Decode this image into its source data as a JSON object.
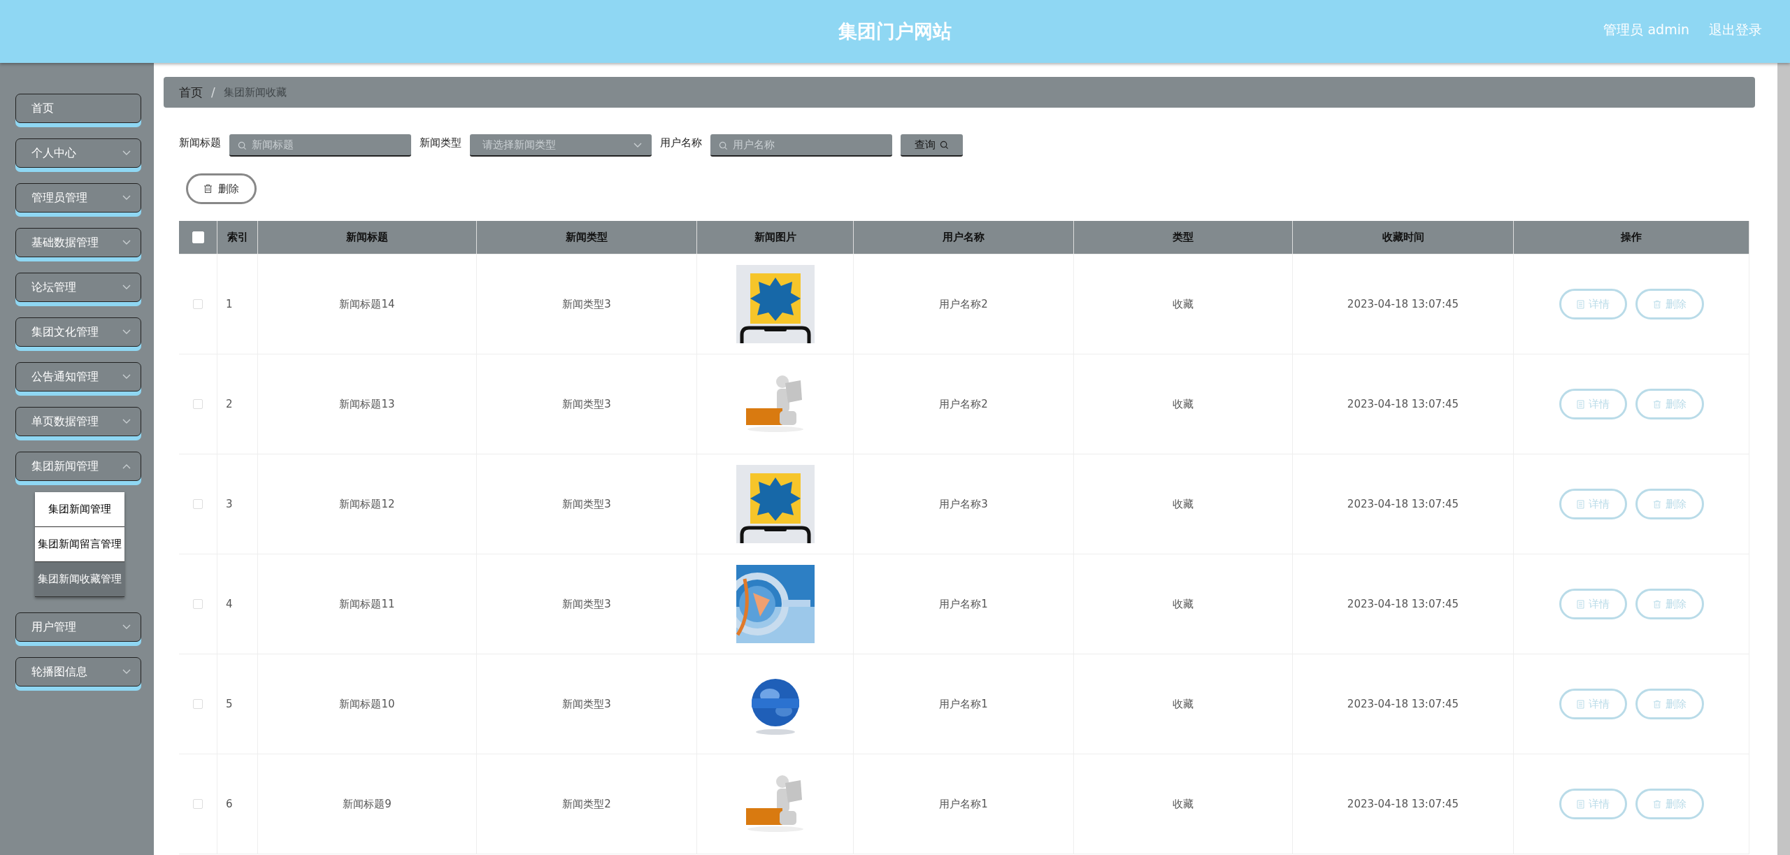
{
  "header": {
    "title": "集团门户网站",
    "user": "管理员 admin",
    "logout": "退出登录"
  },
  "sidebar": {
    "items": [
      {
        "label": "首页",
        "kind": "link"
      },
      {
        "label": "个人中心",
        "kind": "menu",
        "expanded": false
      },
      {
        "label": "管理员管理",
        "kind": "menu",
        "expanded": false
      },
      {
        "label": "基础数据管理",
        "kind": "menu",
        "expanded": false
      },
      {
        "label": "论坛管理",
        "kind": "menu",
        "expanded": false
      },
      {
        "label": "集团文化管理",
        "kind": "menu",
        "expanded": false
      },
      {
        "label": "公告通知管理",
        "kind": "menu",
        "expanded": false
      },
      {
        "label": "单页数据管理",
        "kind": "menu",
        "expanded": false
      },
      {
        "label": "集团新闻管理",
        "kind": "menu",
        "expanded": true,
        "children": [
          {
            "label": "集团新闻管理",
            "selected": false
          },
          {
            "label": "集团新闻留言管理",
            "selected": false
          },
          {
            "label": "集团新闻收藏管理",
            "selected": true
          }
        ]
      },
      {
        "label": "用户管理",
        "kind": "menu",
        "expanded": false
      },
      {
        "label": "轮播图信息",
        "kind": "menu",
        "expanded": false
      }
    ]
  },
  "breadcrumb": {
    "separator": "/",
    "items": [
      "首页",
      "集团新闻收藏"
    ]
  },
  "filters": [
    {
      "label": "新闻标题",
      "kind": "text",
      "placeholder": "新闻标题"
    },
    {
      "label": "新闻类型",
      "kind": "select",
      "placeholder": "请选择新闻类型"
    },
    {
      "label": "用户名称",
      "kind": "text",
      "placeholder": "用户名称"
    }
  ],
  "search_button": "查询",
  "delete_button": "删除",
  "table": {
    "columns": [
      "索引",
      "新闻标题",
      "新闻类型",
      "新闻图片",
      "用户名称",
      "类型",
      "收藏时间",
      "操作"
    ],
    "all_checked": false,
    "rows": [
      {
        "checked": false,
        "index": "1",
        "title": "新闻标题14",
        "news_type": "新闻类型3",
        "image": {
          "kind": "picture"
        },
        "user": "用户名称2",
        "type": "收藏",
        "time": "2023-04-18 13:07:45",
        "actions": [
          "详情",
          "删除"
        ]
      },
      {
        "checked": false,
        "index": "2",
        "title": "新闻标题13",
        "news_type": "新闻类型3",
        "image": {
          "kind": "picture"
        },
        "user": "用户名称2",
        "type": "收藏",
        "time": "2023-04-18 13:07:45",
        "actions": [
          "详情",
          "删除"
        ]
      },
      {
        "checked": false,
        "index": "3",
        "title": "新闻标题12",
        "news_type": "新闻类型3",
        "image": {
          "kind": "picture"
        },
        "user": "用户名称3",
        "type": "收藏",
        "time": "2023-04-18 13:07:45",
        "actions": [
          "详情",
          "删除"
        ]
      },
      {
        "checked": false,
        "index": "4",
        "title": "新闻标题11",
        "news_type": "新闻类型3",
        "image": {
          "kind": "picture"
        },
        "user": "用户名称1",
        "type": "收藏",
        "time": "2023-04-18 13:07:45",
        "actions": [
          "详情",
          "删除"
        ]
      },
      {
        "checked": false,
        "index": "5",
        "title": "新闻标题10",
        "news_type": "新闻类型3",
        "image": {
          "kind": "picture"
        },
        "user": "用户名称1",
        "type": "收藏",
        "time": "2023-04-18 13:07:45",
        "actions": [
          "详情",
          "删除"
        ]
      },
      {
        "checked": false,
        "index": "6",
        "title": "新闻标题9",
        "news_type": "新闻类型2",
        "image": {
          "kind": "picture"
        },
        "user": "用户名称1",
        "type": "收藏",
        "time": "2023-04-18 13:07:45",
        "actions": [
          "详情",
          "删除"
        ]
      }
    ]
  }
}
